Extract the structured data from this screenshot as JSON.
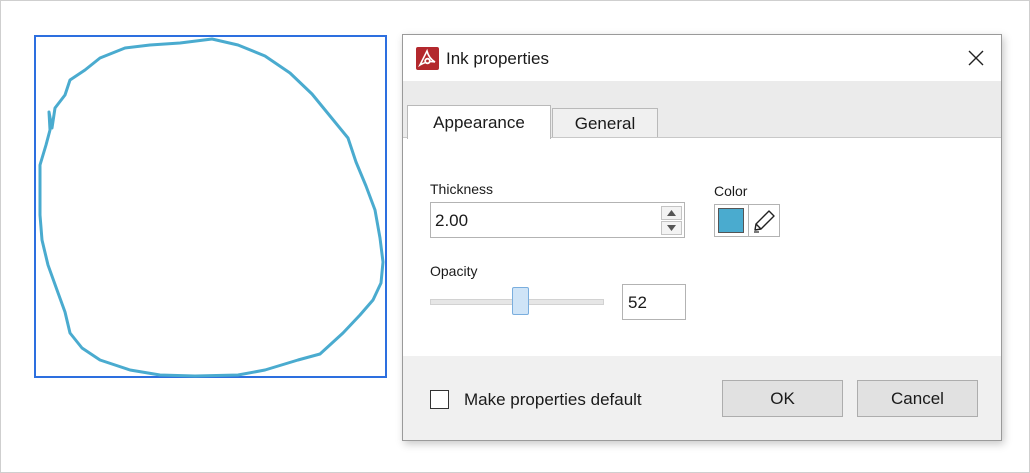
{
  "dialog": {
    "title": "Ink properties",
    "icon": "adobe-acrobat-icon",
    "close_icon": "close-icon"
  },
  "tabs": [
    {
      "label": "Appearance",
      "active": true
    },
    {
      "label": "General",
      "active": false
    }
  ],
  "appearance": {
    "thickness_label": "Thickness",
    "thickness_value": "2.00",
    "color_label": "Color",
    "color_value": "#4aabcf",
    "opacity_label": "Opacity",
    "opacity_value": "52",
    "opacity_slider_percent": 52
  },
  "footer": {
    "make_default_label": "Make properties default",
    "make_default_checked": false,
    "ok_label": "OK",
    "cancel_label": "Cancel"
  },
  "canvas": {
    "ink_color": "#4aabcf",
    "selection_color": "#2d6fdf"
  }
}
